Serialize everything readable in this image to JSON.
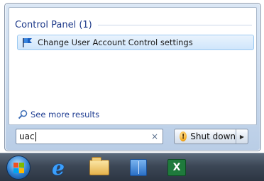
{
  "search_results": {
    "group_title": "Control Panel (1)",
    "items": [
      {
        "label": "Change User Account Control settings",
        "icon": "uac-flag-icon"
      }
    ],
    "see_more": "See more results"
  },
  "search": {
    "value": "uac",
    "clear_glyph": "×"
  },
  "power": {
    "shutdown_label": "Shut down",
    "warning_glyph": "!",
    "arrow_glyph": "▶"
  },
  "taskbar": {
    "icons": [
      "start-orb",
      "internet-explorer-icon",
      "windows-explorer-icon",
      "book-icon",
      "excel-icon"
    ],
    "excel_glyph": "X"
  },
  "colors": {
    "group_title": "#1e3a8a",
    "link": "#1f3d92",
    "highlight": "#cfe5fb"
  }
}
